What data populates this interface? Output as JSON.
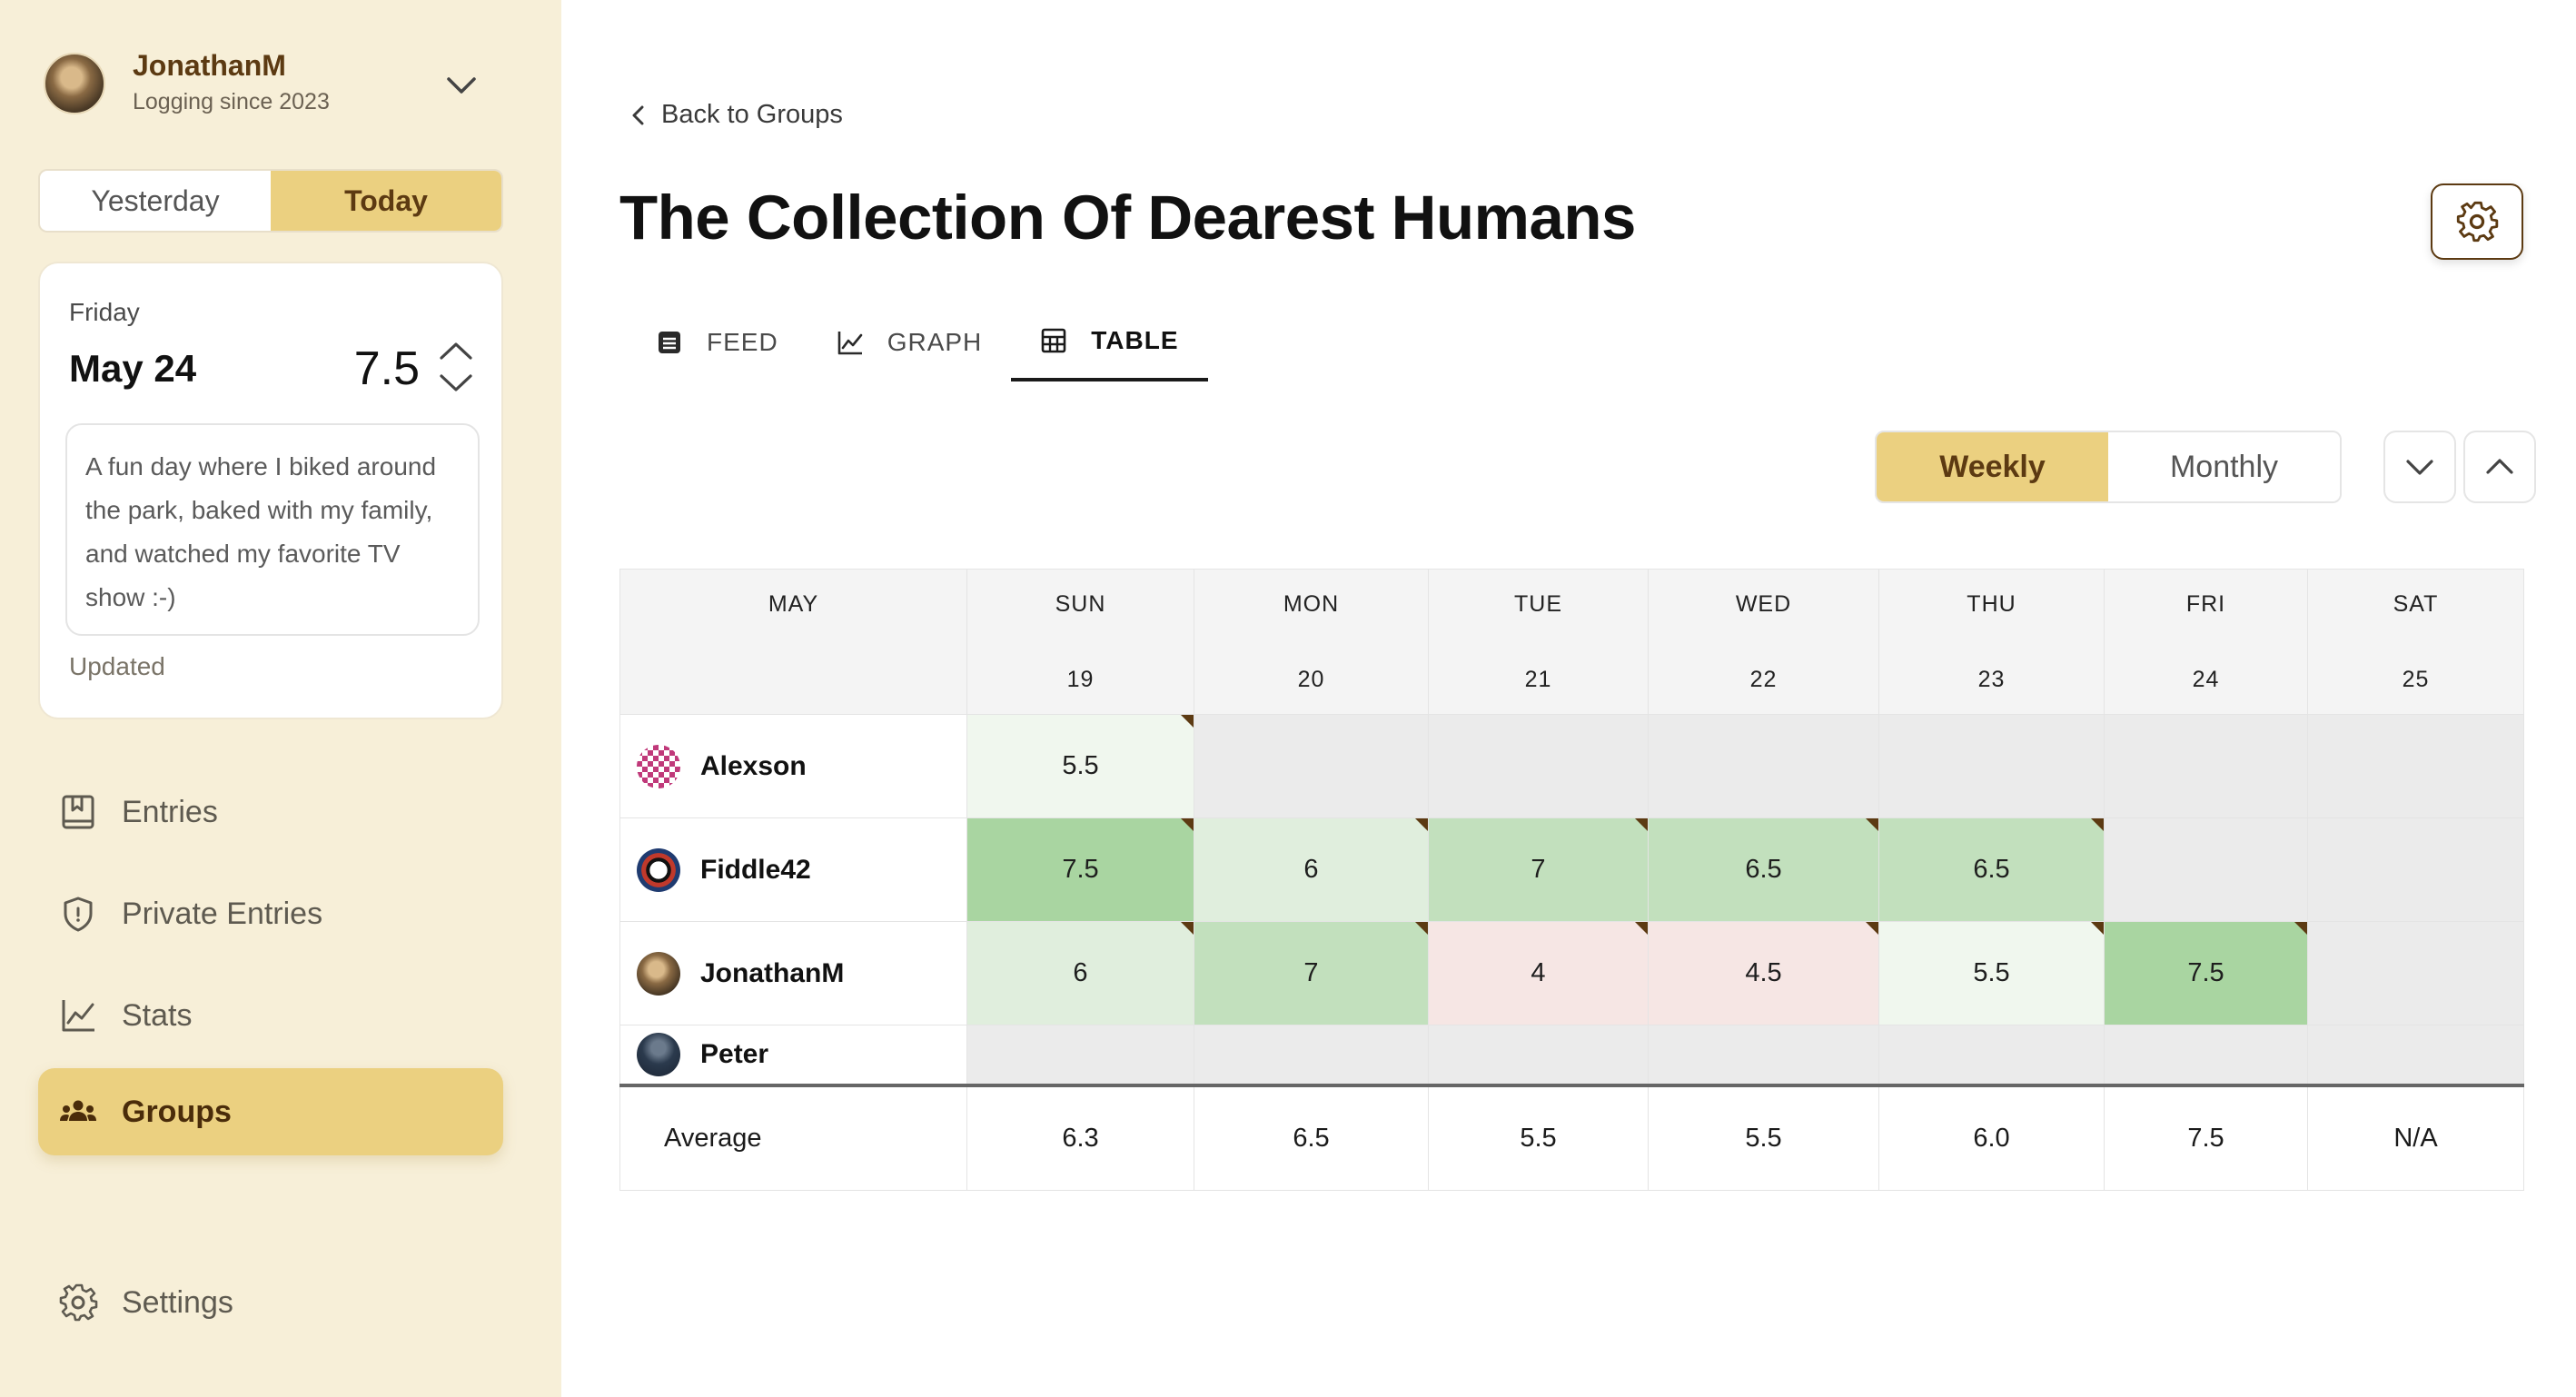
{
  "user": {
    "name": "JonathanM",
    "subtitle": "Logging since 2023"
  },
  "day_toggle": {
    "yesterday": "Yesterday",
    "today": "Today",
    "active": "Today"
  },
  "day_card": {
    "weekday": "Friday",
    "date": "May 24",
    "score": "7.5",
    "note": "A fun day where I biked around the park, baked with my family, and watched my favorite TV show :-)",
    "status": "Updated"
  },
  "nav": {
    "entries": "Entries",
    "private_entries": "Private Entries",
    "stats": "Stats",
    "groups": "Groups",
    "settings": "Settings",
    "active": "Groups"
  },
  "main": {
    "back_label": "Back to Groups",
    "title": "The Collection Of Dearest Humans",
    "tabs": {
      "feed": "FEED",
      "graph": "GRAPH",
      "table": "TABLE",
      "active": "TABLE"
    },
    "period": {
      "weekly": "Weekly",
      "monthly": "Monthly",
      "active": "Weekly"
    }
  },
  "colors": {
    "accent": "#ebd080",
    "brand_brown": "#5c3a12",
    "sidebar_bg": "#f7efd8",
    "score_high": "#a9d5a1",
    "score_mid": "#c2e0bd",
    "score_lowmid": "#e0eedd",
    "score_low": "#f0f7ee",
    "score_bad": "#f6e6e4",
    "empty_cell": "#ebebeb"
  },
  "table": {
    "month": "MAY",
    "days": [
      {
        "day": "SUN",
        "num": "19"
      },
      {
        "day": "MON",
        "num": "20"
      },
      {
        "day": "TUE",
        "num": "21"
      },
      {
        "day": "WED",
        "num": "22"
      },
      {
        "day": "THU",
        "num": "23"
      },
      {
        "day": "FRI",
        "num": "24"
      },
      {
        "day": "SAT",
        "num": "25"
      }
    ],
    "rows": [
      {
        "name": "Alexson",
        "avatar": "pattern-avatar",
        "cells": [
          {
            "v": "5.5",
            "tone": "low",
            "note": true
          },
          {
            "v": "",
            "tone": "empty"
          },
          {
            "v": "",
            "tone": "empty"
          },
          {
            "v": "",
            "tone": "empty"
          },
          {
            "v": "",
            "tone": "empty"
          },
          {
            "v": "",
            "tone": "empty"
          },
          {
            "v": "",
            "tone": "empty"
          }
        ]
      },
      {
        "name": "Fiddle42",
        "avatar": "panda-avatar",
        "cells": [
          {
            "v": "7.5",
            "tone": "high",
            "note": true
          },
          {
            "v": "6",
            "tone": "lowmid",
            "note": true
          },
          {
            "v": "7",
            "tone": "mid",
            "note": true
          },
          {
            "v": "6.5",
            "tone": "mid",
            "note": true
          },
          {
            "v": "6.5",
            "tone": "mid",
            "note": true
          },
          {
            "v": "",
            "tone": "empty"
          },
          {
            "v": "",
            "tone": "empty"
          }
        ]
      },
      {
        "name": "JonathanM",
        "avatar": "dog-avatar",
        "cells": [
          {
            "v": "6",
            "tone": "lowmid",
            "note": true
          },
          {
            "v": "7",
            "tone": "mid",
            "note": true
          },
          {
            "v": "4",
            "tone": "bad",
            "note": true
          },
          {
            "v": "4.5",
            "tone": "bad",
            "note": true
          },
          {
            "v": "5.5",
            "tone": "low",
            "note": true
          },
          {
            "v": "7.5",
            "tone": "high",
            "note": true
          },
          {
            "v": "",
            "tone": "empty"
          }
        ]
      },
      {
        "name": "Peter",
        "avatar": "photo-avatar",
        "short": true,
        "cells": [
          {
            "v": "",
            "tone": "empty"
          },
          {
            "v": "",
            "tone": "empty"
          },
          {
            "v": "",
            "tone": "empty"
          },
          {
            "v": "",
            "tone": "empty"
          },
          {
            "v": "",
            "tone": "empty"
          },
          {
            "v": "",
            "tone": "empty"
          },
          {
            "v": "",
            "tone": "empty"
          }
        ]
      }
    ],
    "average_label": "Average",
    "averages": [
      "6.3",
      "6.5",
      "5.5",
      "5.5",
      "6.0",
      "7.5",
      "N/A"
    ]
  }
}
